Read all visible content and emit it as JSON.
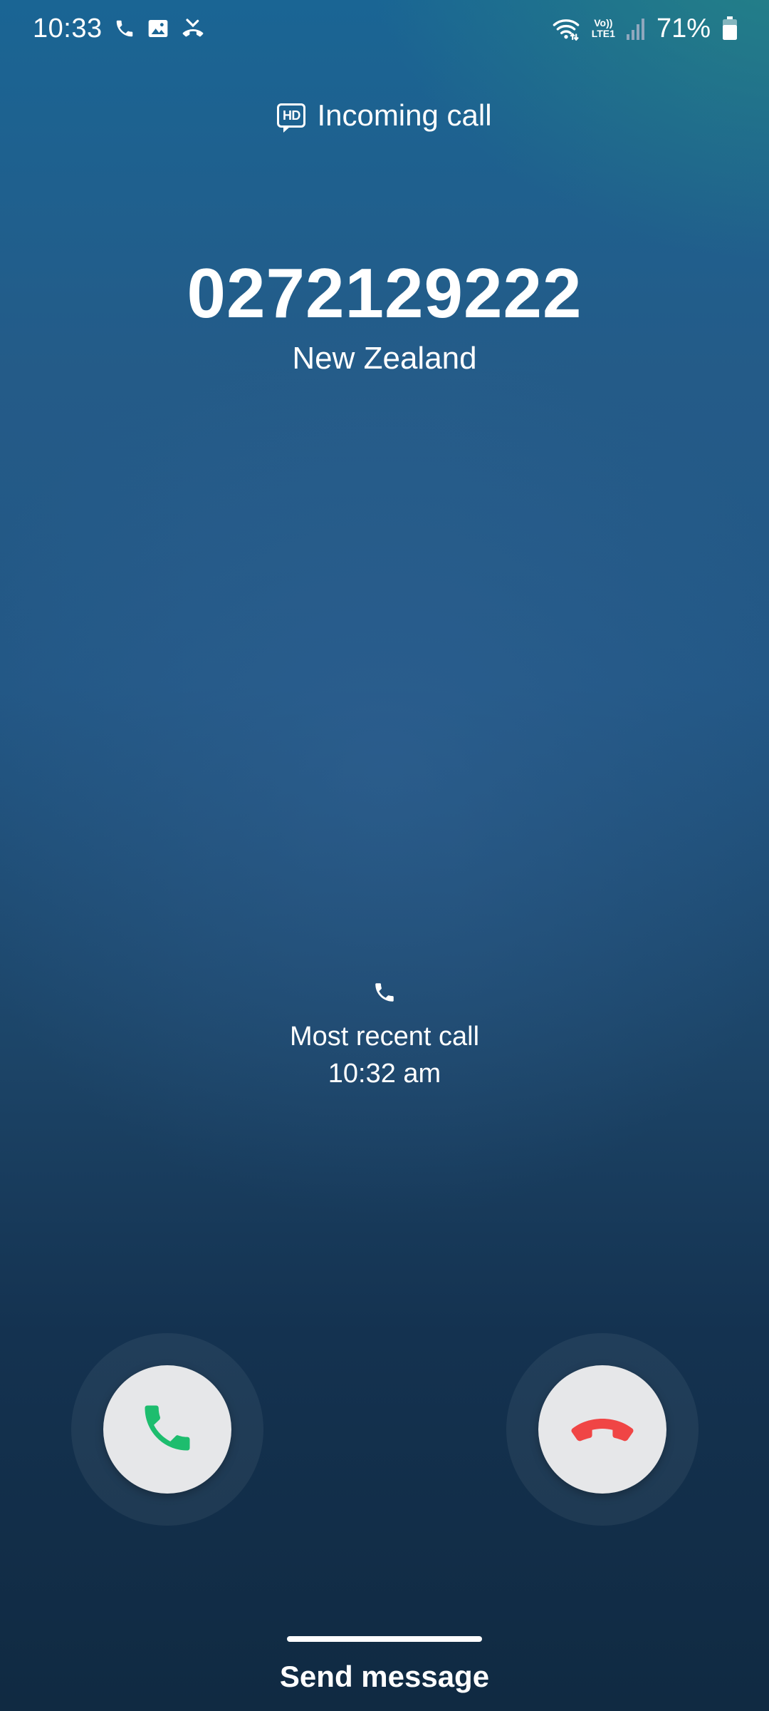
{
  "status_bar": {
    "time": "10:33",
    "volte_top": "Vo))",
    "volte_bottom": "LTE1",
    "battery_percent": "71%",
    "icons": [
      "phone-icon",
      "gallery-icon",
      "missed-call-icon",
      "wifi-icon",
      "volte-icon",
      "signal-icon",
      "battery-icon"
    ]
  },
  "call": {
    "status": "Incoming call",
    "hd_badge": "HD",
    "number": "0272129222",
    "region": "New Zealand"
  },
  "recent_call": {
    "label": "Most recent call",
    "time": "10:32 am"
  },
  "actions": {
    "send_message": "Send message",
    "accept_color": "#1dbd6e",
    "decline_color": "#f04545"
  }
}
